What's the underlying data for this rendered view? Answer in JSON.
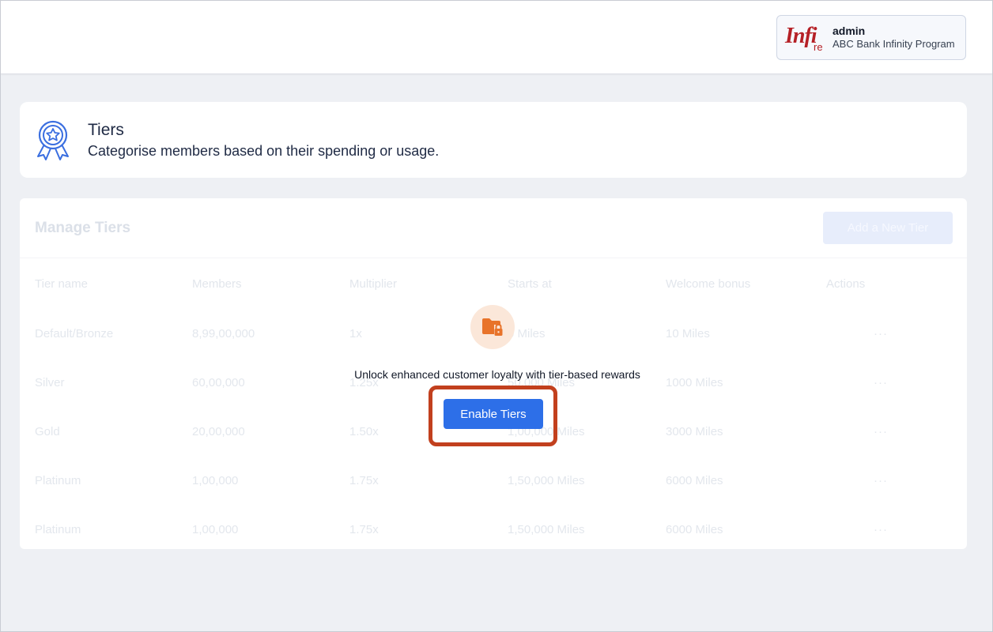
{
  "header": {
    "logo": {
      "main": "Infi",
      "sub": "re"
    },
    "account": {
      "name": "admin",
      "program": "ABC Bank Infinity Program"
    }
  },
  "page": {
    "icon": "award-badge-icon",
    "title": "Tiers",
    "subtitle": "Categorise members based on their spending or usage."
  },
  "manage": {
    "title": "Manage Tiers",
    "add_button": "Add a New Tier",
    "columns": [
      "Tier name",
      "Members",
      "Multiplier",
      "Starts at",
      "Welcome bonus",
      "Actions"
    ],
    "rows": [
      [
        "Default/Bronze",
        "8,99,00,000",
        "1x",
        "0 Miles",
        "10 Miles",
        "···"
      ],
      [
        "Silver",
        "60,00,000",
        "1.25x",
        "50,000 Miles",
        "1000 Miles",
        "···"
      ],
      [
        "Gold",
        "20,00,000",
        "1.50x",
        "1,00,000 Miles",
        "3000 Miles",
        "···"
      ],
      [
        "Platinum",
        "1,00,000",
        "1.75x",
        "1,50,000 Miles",
        "6000 Miles",
        "···"
      ],
      [
        "Platinum",
        "1,00,000",
        "1.75x",
        "1,50,000 Miles",
        "6000 Miles",
        "···"
      ]
    ]
  },
  "lock": {
    "icon": "locked-folder-icon",
    "message": "Unlock enhanced customer loyalty with tier-based rewards",
    "enable_button": "Enable Tiers",
    "accent_color": "#e8732a",
    "button_color": "#2d6fe8",
    "highlight_color": "#c2401e"
  }
}
